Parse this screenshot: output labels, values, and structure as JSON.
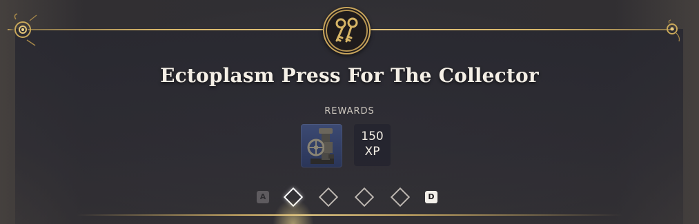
{
  "quest": {
    "title": "Ectoplasm Press For The Collector",
    "rewards_label": "REWARDS",
    "reward_item_icon": "ectoplasm-press-icon",
    "xp_amount": "150",
    "xp_unit": "XP"
  },
  "header": {
    "emblem_icon": "keys-icon"
  },
  "pager": {
    "prev_key": "A",
    "next_key": "D",
    "pages": 4,
    "active_page": 1
  },
  "colors": {
    "gold": "#d8b76a",
    "title": "#f4efe6",
    "panel": "#2c2b32"
  }
}
